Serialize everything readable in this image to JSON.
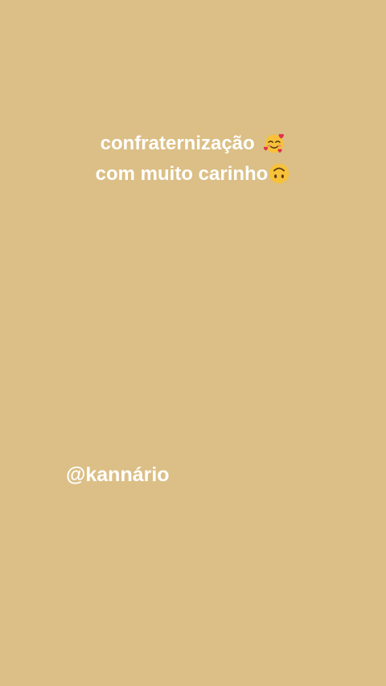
{
  "caption": {
    "line1": "confraternização",
    "line1_emoji": "smiling-face-with-hearts-icon",
    "line2": "com muito carinho",
    "line2_emoji": "upside-down-face-icon"
  },
  "handle": "@kannário",
  "colors": {
    "background": "#dbbf86",
    "text": "#ffffff"
  }
}
